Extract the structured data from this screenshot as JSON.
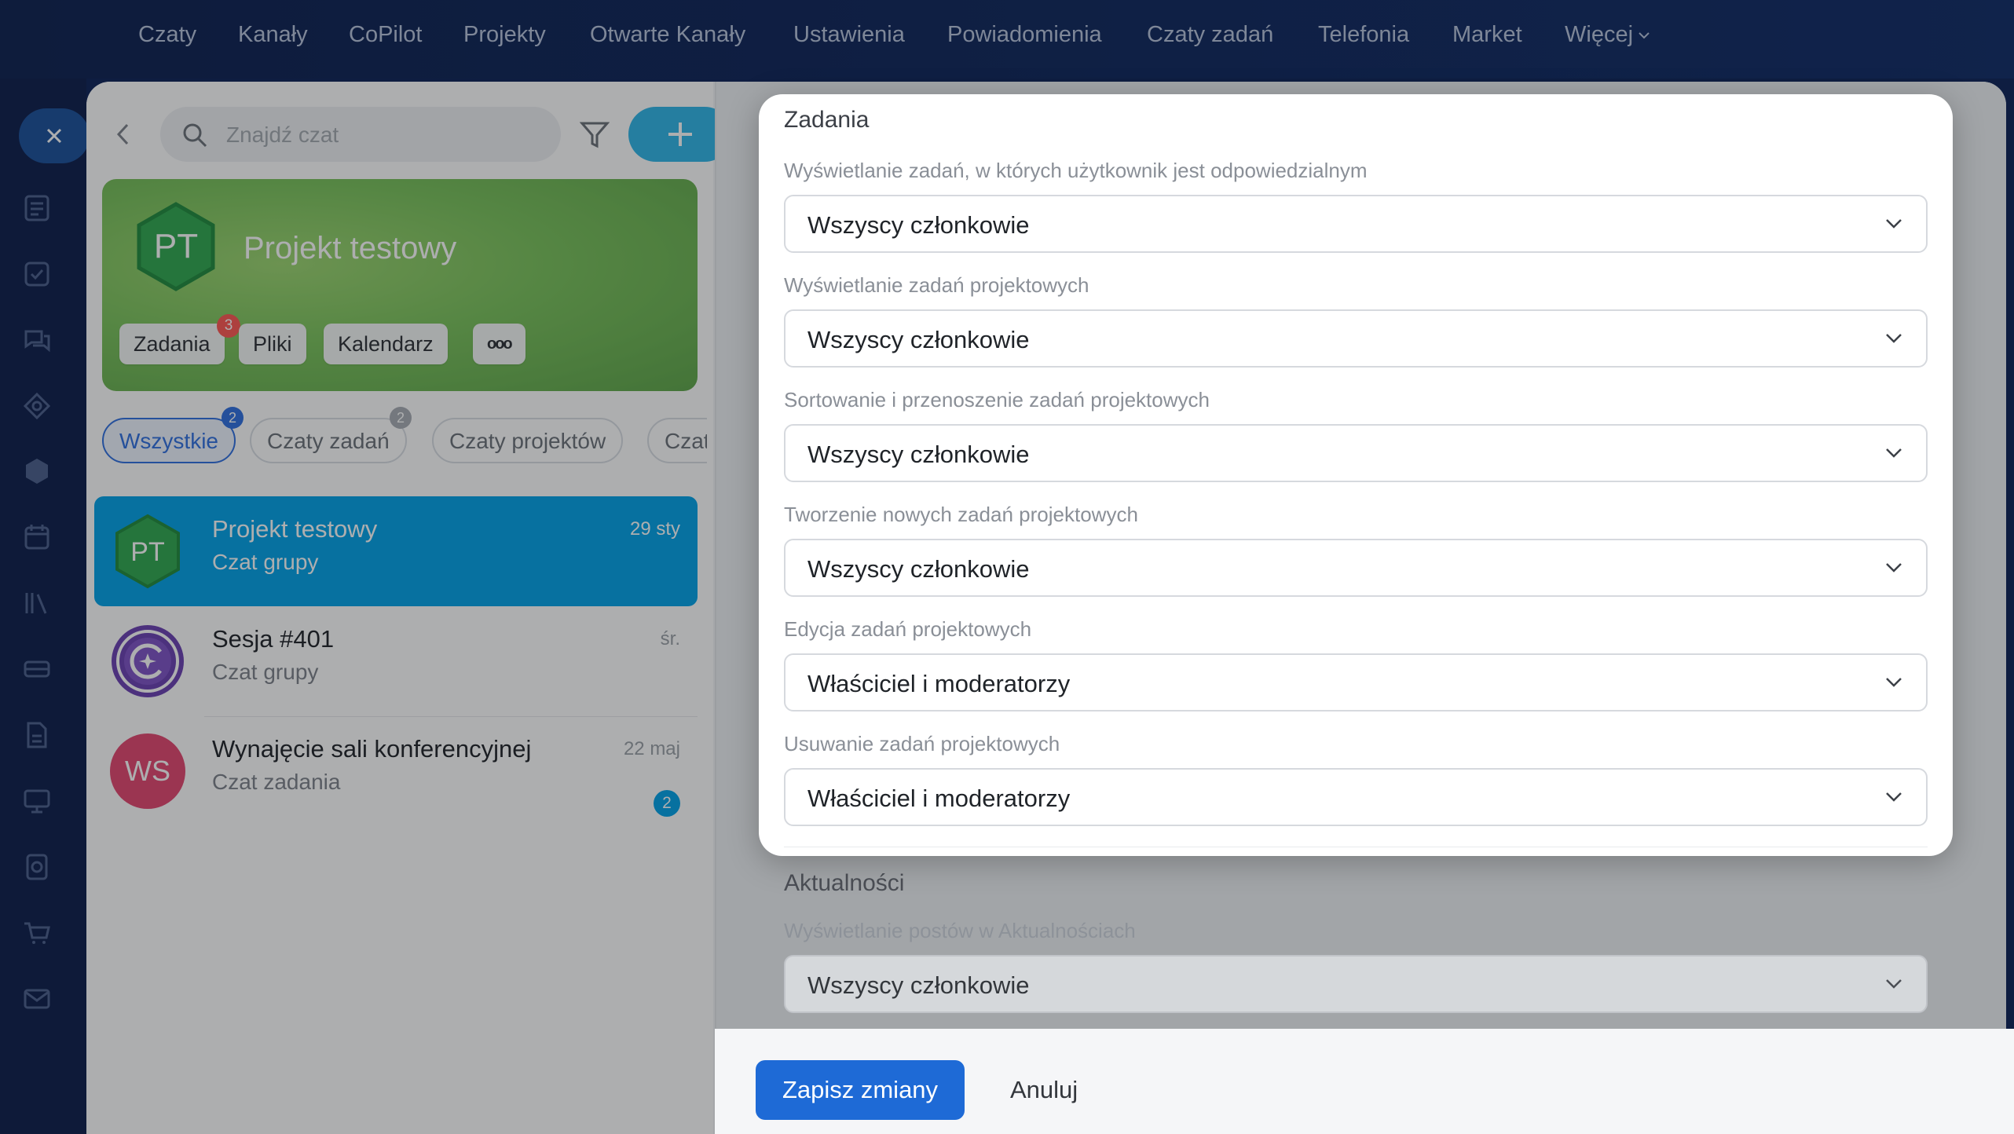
{
  "topnav": {
    "items": [
      "Czaty",
      "Kanały",
      "CoPilot",
      "Projekty",
      "Otwarte Kanały",
      "Ustawienia",
      "Powiadomienia",
      "Czaty zadań",
      "Telefonia",
      "Market",
      "Więcej"
    ]
  },
  "search": {
    "placeholder": "Znajdź czat"
  },
  "project": {
    "initials": "PT",
    "name": "Projekt testowy",
    "chips": {
      "tasks": "Zadania",
      "files": "Pliki",
      "calendar": "Kalendarz",
      "more": "ooo"
    },
    "tasks_badge": "3"
  },
  "filter_tabs": {
    "all": "Wszystkie",
    "all_badge": "2",
    "task_chats": "Czaty zadań",
    "task_chats_badge": "2",
    "project_chats": "Czaty projektów",
    "cut": "Czat"
  },
  "chats": [
    {
      "initials": "PT",
      "title": "Projekt testowy",
      "subtitle": "Czat grupy",
      "date": "29 sty"
    },
    {
      "initials": "",
      "title": "Sesja #401",
      "subtitle": "Czat grupy",
      "date": "śr."
    },
    {
      "initials": "WS",
      "title": "Wynajęcie sali konferencyjnej",
      "subtitle": "Czat zadania",
      "date": "22 maj",
      "badge": "2"
    }
  ],
  "tasks_section": {
    "title": "Zadania",
    "fields": [
      {
        "label": "Wyświetlanie zadań, w których użytkownik jest odpowiedzialnym",
        "value": "Wszyscy członkowie"
      },
      {
        "label": "Wyświetlanie zadań projektowych",
        "value": "Wszyscy członkowie"
      },
      {
        "label": "Sortowanie i przenoszenie zadań projektowych",
        "value": "Wszyscy członkowie"
      },
      {
        "label": "Tworzenie nowych zadań projektowych",
        "value": "Wszyscy członkowie"
      },
      {
        "label": "Edycja zadań projektowych",
        "value": "Właściciel i moderatorzy"
      },
      {
        "label": "Usuwanie zadań projektowych",
        "value": "Właściciel i moderatorzy"
      }
    ]
  },
  "news_section": {
    "title": "Aktualności",
    "field": {
      "label": "Wyświetlanie postów w Aktualnościach",
      "value": "Wszyscy członkowie"
    }
  },
  "footer": {
    "save": "Zapisz zmiany",
    "cancel": "Anuluj"
  },
  "colors": {
    "accent": "#1e6ad6",
    "selected_row": "#00a2e8",
    "project_green": "#2fa84f",
    "badge_red": "#ff5752"
  }
}
